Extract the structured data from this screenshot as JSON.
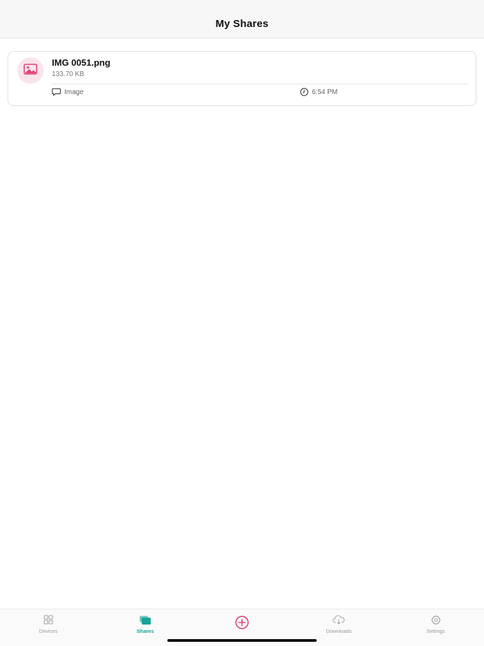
{
  "header": {
    "title": "My Shares"
  },
  "shares": [
    {
      "file_name": "IMG 0051.png",
      "file_size": "133.70 KB",
      "type_label": "Image",
      "time": "6:54 PM",
      "type_icon": "chat-bubble-icon",
      "time_icon": "clock-icon",
      "thumbnail_icon": "image-icon"
    }
  ],
  "tab_bar": {
    "active": "Shares",
    "tabs": [
      {
        "label": "Devices",
        "icon": "grid-icon"
      },
      {
        "label": "Shares",
        "icon": "stacked-cards-icon"
      },
      {
        "label": "",
        "icon": "add-circle-icon"
      },
      {
        "label": "Downloads",
        "icon": "cloud-download-icon"
      },
      {
        "label": "Settings",
        "icon": "gear-icon"
      }
    ]
  },
  "colors": {
    "accent_teal": "#17a398",
    "accent_pink": "#e0407a",
    "avatar_bg": "#fbe3ec",
    "inactive_gray": "#9a9a9a"
  }
}
